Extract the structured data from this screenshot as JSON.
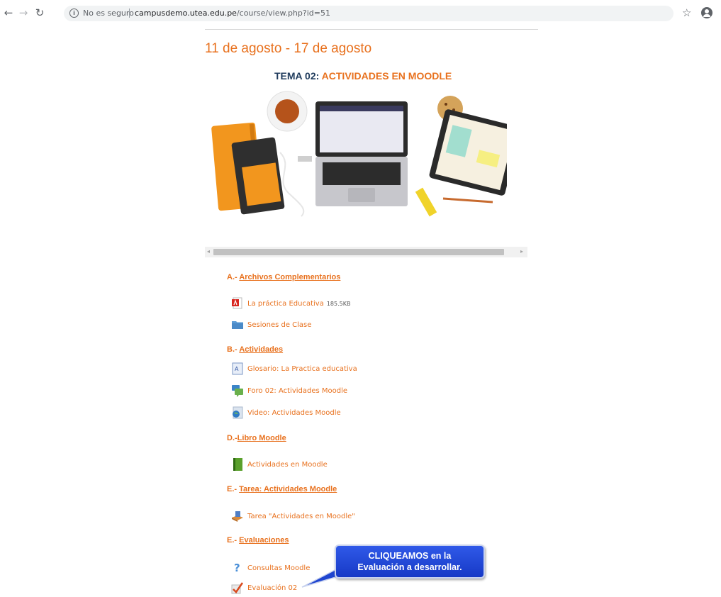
{
  "browser": {
    "security_label": "No es seguro",
    "url_host": "campusdemo.utea.edu.pe",
    "url_path": "/course/view.php?id=51"
  },
  "week": {
    "title": "11 de agosto - 17 de agosto"
  },
  "topic": {
    "prefix": "TEMA 02:",
    "name": "ACTIVIDADES EN MOODLE"
  },
  "sections": [
    {
      "prefix": "A.-",
      "title": "Archivos Complementarios",
      "items": [
        {
          "label": "La práctica Educativa",
          "size": "185.5KB",
          "icon": "pdf-icon"
        },
        {
          "label": "Sesiones de Clase",
          "icon": "folder-icon"
        }
      ]
    },
    {
      "prefix": "B.-",
      "title": "Actividades",
      "items": [
        {
          "label": "Glosario: La Practica educativa",
          "icon": "glossary-icon"
        },
        {
          "label": "Foro 02: Actividades Moodle",
          "icon": "forum-icon"
        },
        {
          "label": "Video: Actividades Moodle",
          "icon": "url-icon"
        }
      ]
    },
    {
      "prefix": "D.-",
      "title": "Libro Moodle",
      "items": [
        {
          "label": "Actividades en Moodle",
          "icon": "book-icon"
        }
      ]
    },
    {
      "prefix": "E.-",
      "title": "Tarea: Actividades Moodle",
      "items": [
        {
          "label": "Tarea \"Actividades en Moodle\"",
          "icon": "assignment-icon"
        }
      ]
    },
    {
      "prefix": "E.-",
      "title": "Evaluaciones",
      "items": [
        {
          "label": "Consultas Moodle",
          "icon": "question-icon"
        },
        {
          "label": "Evaluación 02",
          "icon": "quiz-icon"
        }
      ]
    }
  ],
  "callout": {
    "line1": "CLIQUEAMOS en la",
    "line2": "Evaluación a desarrollar."
  },
  "colors": {
    "accent": "#e8711e",
    "topic_dark": "#1f3b5c",
    "callout_blue": "#1739c6"
  }
}
